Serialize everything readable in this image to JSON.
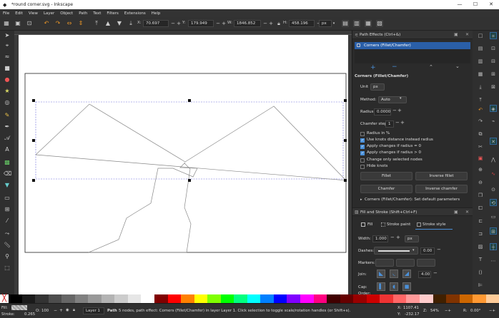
{
  "window": {
    "title": "*round corner.svg - Inkscape"
  },
  "menu": [
    "File",
    "Edit",
    "View",
    "Layer",
    "Object",
    "Path",
    "Text",
    "Filters",
    "Extensions",
    "Help"
  ],
  "toolbar": {
    "x_label": "X:",
    "x_value": "70.697",
    "y_label": "Y:",
    "y_value": "179.949",
    "w_label": "W:",
    "w_value": "1846.852",
    "h_label": "H:",
    "h_value": "458.196",
    "unit": "px"
  },
  "path_effects": {
    "dialog_title": "Path Effects (Ctrl+&)",
    "effect_item": "Corners (Fillet/Chamfer)",
    "section_title": "Corners (Fillet/Chamfer)",
    "unit_label": "Unit",
    "unit_value": "px",
    "method_label": "Method:",
    "method_value": "Auto",
    "radius_label": "Radius:",
    "radius_value": "0.0000",
    "chamfer_label": "Chamfer steps:",
    "chamfer_value": "1",
    "checks": [
      {
        "label": "Radius in %",
        "checked": false
      },
      {
        "label": "Use knots distance instead radius",
        "checked": true
      },
      {
        "label": "Apply changes if radius = 0",
        "checked": true
      },
      {
        "label": "Apply changes if radius > 0",
        "checked": true
      },
      {
        "label": "Change only selected nodes",
        "checked": false
      },
      {
        "label": "Hide knots",
        "checked": false
      }
    ],
    "buttons": {
      "fillet": "Fillet",
      "inverse_fillet": "Inverse fillet",
      "chamfer": "Chamfer",
      "inverse_chamfer": "Inverse chamfer"
    },
    "defaults": "Corners (Fillet/Chamfer): Set default parameters"
  },
  "fill_stroke": {
    "dialog_title": "Fill and Stroke (Shift+Ctrl+F)",
    "tabs": [
      "Fill",
      "Stroke paint",
      "Stroke style"
    ],
    "width_label": "Width:",
    "width_value": "1.000",
    "width_unit": "px",
    "dashes_label": "Dashes:",
    "dashes_value": "0.00",
    "markers_label": "Markers:",
    "join_label": "Join:",
    "join_value": "4.00",
    "cap_label": "Cap:",
    "order_label": "Order:"
  },
  "status": {
    "fill_label": "Fill:",
    "fill_value": "",
    "stroke_label": "Stroke:",
    "stroke_value": "None",
    "stroke_width": "0.265",
    "opacity_label": "O:",
    "opacity_value": "100",
    "layer": "Layer 1",
    "message_bold": "Path",
    "message": "5 nodes, path effect: Corners (Fillet/Chamfer) in layer Layer 1. Click selection to toggle scale/rotation handles (or Shift+s).",
    "cursor_x_label": "X:",
    "cursor_x": "1107.41",
    "cursor_y_label": "Y:",
    "cursor_y": "-232.17",
    "zoom_label": "Z:",
    "zoom_value": "54%",
    "rotation_label": "R:",
    "rotation_value": "0.00°"
  },
  "colors": {
    "accent": "#4a90d9",
    "selection": "#2a5fa8",
    "dashed": "#6b6bdd"
  }
}
